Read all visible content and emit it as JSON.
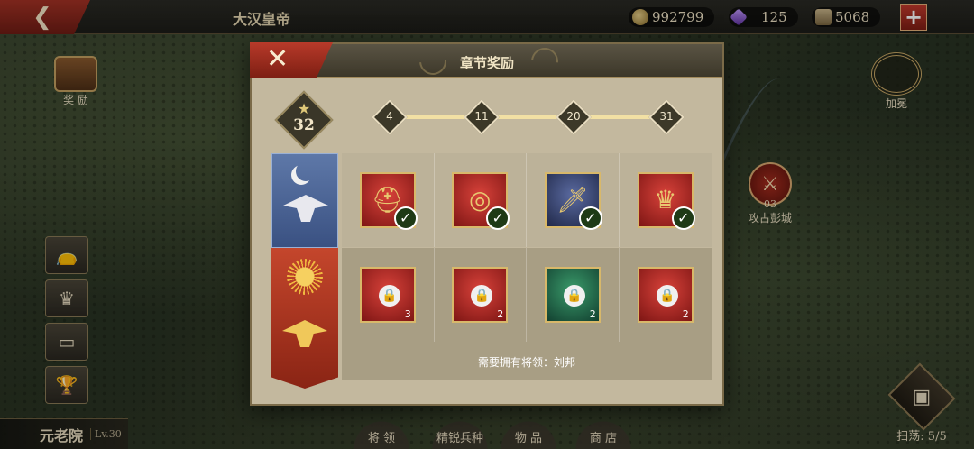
{
  "topbar": {
    "back_icon": "back-arrow",
    "title": "大汉皇帝",
    "gold": "992799",
    "gems": "125",
    "troops": "5068",
    "plus_label": "+"
  },
  "left_side": {
    "rewards_label": "奖 励",
    "buttons": [
      "bag-icon",
      "crown-icon",
      "chest-icon",
      "trophy-icon"
    ],
    "senate_name": "元老院",
    "senate_level": "Lv.30"
  },
  "right_side": {
    "coronation_label": "加冕",
    "siege_num": "03",
    "siege_label": "攻占彭城",
    "sweep_label": "扫荡: 5/5"
  },
  "bottom_nav": [
    "将 领",
    "精锐兵种",
    "物 品",
    "商 店"
  ],
  "dialog": {
    "title": "章节奖励",
    "close_label": "✕",
    "stars": "32",
    "milestones": [
      "4",
      "11",
      "20",
      "31"
    ],
    "row_top_items": [
      {
        "name": "helmet",
        "claimed": true
      },
      {
        "name": "ring",
        "claimed": true
      },
      {
        "name": "sword",
        "claimed": true
      },
      {
        "name": "crown",
        "claimed": true
      }
    ],
    "row_bottom_items": [
      {
        "name": "helmet",
        "qty": "3"
      },
      {
        "name": "ring",
        "qty": "2"
      },
      {
        "name": "gauntlet",
        "qty": "2"
      },
      {
        "name": "crown",
        "qty": "2"
      }
    ],
    "requirement": "需要拥有将领：刘邦"
  },
  "colors": {
    "accent_red": "#a43225",
    "gold": "#d8b86a"
  }
}
